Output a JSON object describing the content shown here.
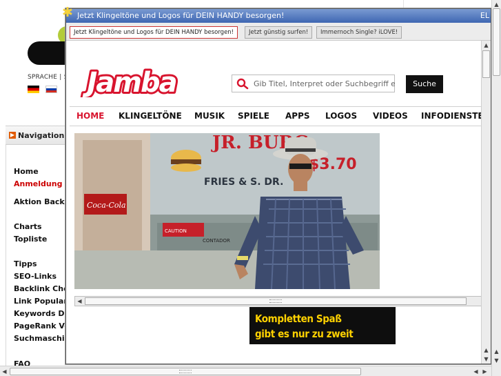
{
  "background": {
    "sprache_label": "SPRACHE | Я",
    "nav_header": "Navigation",
    "nav_items": [
      {
        "label": "Home"
      },
      {
        "label": "Anmeldung"
      },
      {
        "label": "Aktion Backli"
      },
      {
        "label": "Charts"
      },
      {
        "label": "Topliste"
      },
      {
        "label": "Tipps"
      },
      {
        "label": "SEO-Links"
      },
      {
        "label": "Backlink Che"
      },
      {
        "label": "Link Populari"
      },
      {
        "label": "Keywords Di"
      },
      {
        "label": "PageRank Vo"
      },
      {
        "label": "Suchmaschin"
      },
      {
        "label": "FAQ"
      }
    ]
  },
  "popup": {
    "title": "Jetzt Klingeltöne und Logos für DEIN HANDY besorgen!",
    "title_right": "EL",
    "tabs": [
      {
        "label": "Jetzt Klingeltöne und Logos für DEIN HANDY besorgen!",
        "active": true
      },
      {
        "label": "Jetzt günstig surfen!",
        "active": false
      },
      {
        "label": "Immernoch Single? iLOVE!",
        "active": false
      }
    ],
    "brand": "Jamba",
    "search": {
      "placeholder": "Gib Titel, Interpret oder Suchbegriff ein",
      "button": "Suche"
    },
    "main_nav": [
      {
        "label": "HOME",
        "active": true
      },
      {
        "label": "KLINGELTÖNE",
        "active": false
      },
      {
        "label": "MUSIK",
        "active": false
      },
      {
        "label": "SPIELE",
        "active": false
      },
      {
        "label": "APPS",
        "active": false
      },
      {
        "label": "LOGOS",
        "active": false
      },
      {
        "label": "VIDEOS",
        "active": false
      },
      {
        "label": "INFODIENSTE",
        "active": false
      }
    ],
    "hero": {
      "sign_text": "JR. BURG",
      "sign_sub": "FRIES & S. DR.",
      "price": "$3.70",
      "cola": "Coca-Cola",
      "counter_sign": "CONTADOR",
      "caution": "CAUTION"
    },
    "promo": {
      "line1": "Kompletten Spaß",
      "line2": "gibt es nur zu zweit"
    }
  },
  "colors": {
    "brand_red": "#d8142e",
    "titlebar": "#4a6fb8",
    "promo_text": "#ffd200"
  }
}
